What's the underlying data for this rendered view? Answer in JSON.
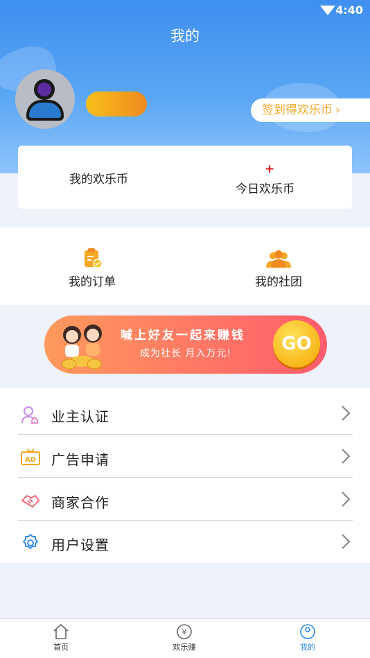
{
  "status_bar": {
    "time": "4:40"
  },
  "header": {
    "title": "我的",
    "checkin_label": "签到得欢乐币",
    "checkin_chevron": "›"
  },
  "coins": {
    "my_label": "我的欢乐币",
    "today_value": "+",
    "today_label": "今日欢乐币"
  },
  "quick_links": {
    "orders": "我的订单",
    "club": "我的社团"
  },
  "banner": {
    "title": "喊上好友一起来赚钱",
    "subtitle": "成为社长  月入万元!",
    "go": "GO"
  },
  "menu": [
    {
      "label": "业主认证",
      "icon": "owner-verify-icon",
      "color": "#c58be8"
    },
    {
      "label": "广告申请",
      "icon": "ad-icon",
      "color": "#f5a623"
    },
    {
      "label": "商家合作",
      "icon": "handshake-icon",
      "color": "#f06a7a"
    },
    {
      "label": "用户设置",
      "icon": "gear-icon",
      "color": "#3a8ee6"
    }
  ],
  "tabs": [
    {
      "label": "首页",
      "icon": "home-icon",
      "active": false
    },
    {
      "label": "欢乐赚",
      "icon": "yen-icon",
      "active": false
    },
    {
      "label": "我的",
      "icon": "profile-icon",
      "active": true
    }
  ],
  "colors": {
    "primary": "#3f8ff0",
    "accent": "#f6a623",
    "active_tab": "#2b8ae8"
  }
}
